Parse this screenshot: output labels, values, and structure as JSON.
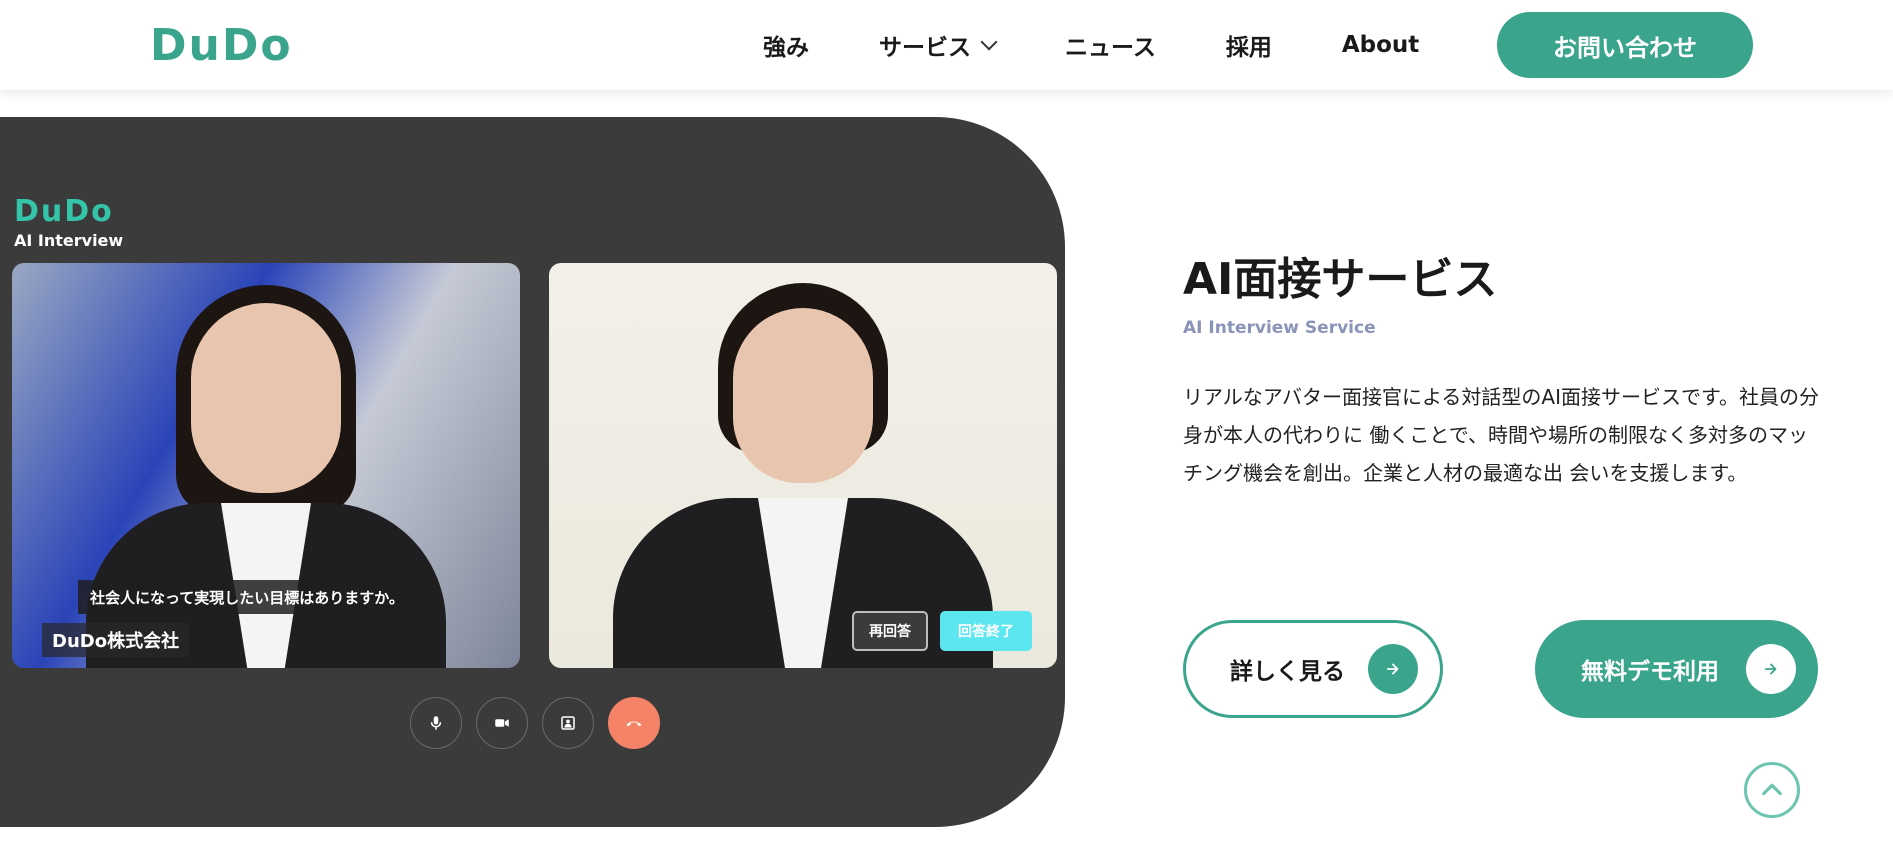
{
  "header": {
    "logo_text": "DuDo",
    "nav": [
      {
        "label": "強み"
      },
      {
        "label": "サービス"
      },
      {
        "label": "ニュース"
      },
      {
        "label": "採用"
      },
      {
        "label": "About"
      }
    ],
    "contact_label": "お問い合わせ"
  },
  "app": {
    "logo_text": "DuDo",
    "logo_sub": "AI Interview",
    "caption": "社会人になって実現したい目標はありますか。",
    "company": "DuDo株式会社",
    "reanswer_label": "再回答",
    "done_label": "回答終了"
  },
  "content": {
    "title": "AI面接サービス",
    "subtitle": "AI Interview Service",
    "description": "リアルなアバター面接官による対話型のAI面接サービスです。社員の分身が本人の代わりに 働くことで、時間や場所の制限なく多対多のマッチング機会を創出。企業と人材の最適な出 会いを支援します。",
    "more_label": "詳しく見る",
    "demo_label": "無料デモ利用"
  },
  "colors": {
    "brand": "#3aa58c",
    "end_call": "#f48367",
    "done_button": "#5ce6f0"
  }
}
